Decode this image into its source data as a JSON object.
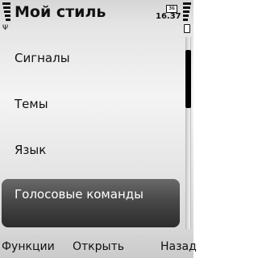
{
  "header": {
    "title": "Мой стиль",
    "clock": "16.37",
    "network_badge": "3G"
  },
  "menu": {
    "items": [
      {
        "label": "Сигналы"
      },
      {
        "label": "Темы"
      },
      {
        "label": "Язык"
      },
      {
        "label": "Голосовые команды",
        "selected": true
      }
    ]
  },
  "softkeys": {
    "left": "Функции",
    "middle": "Открыть",
    "right": "Назад"
  },
  "scroll": {
    "position_fraction": 0.07,
    "visible_fraction": 0.3
  }
}
